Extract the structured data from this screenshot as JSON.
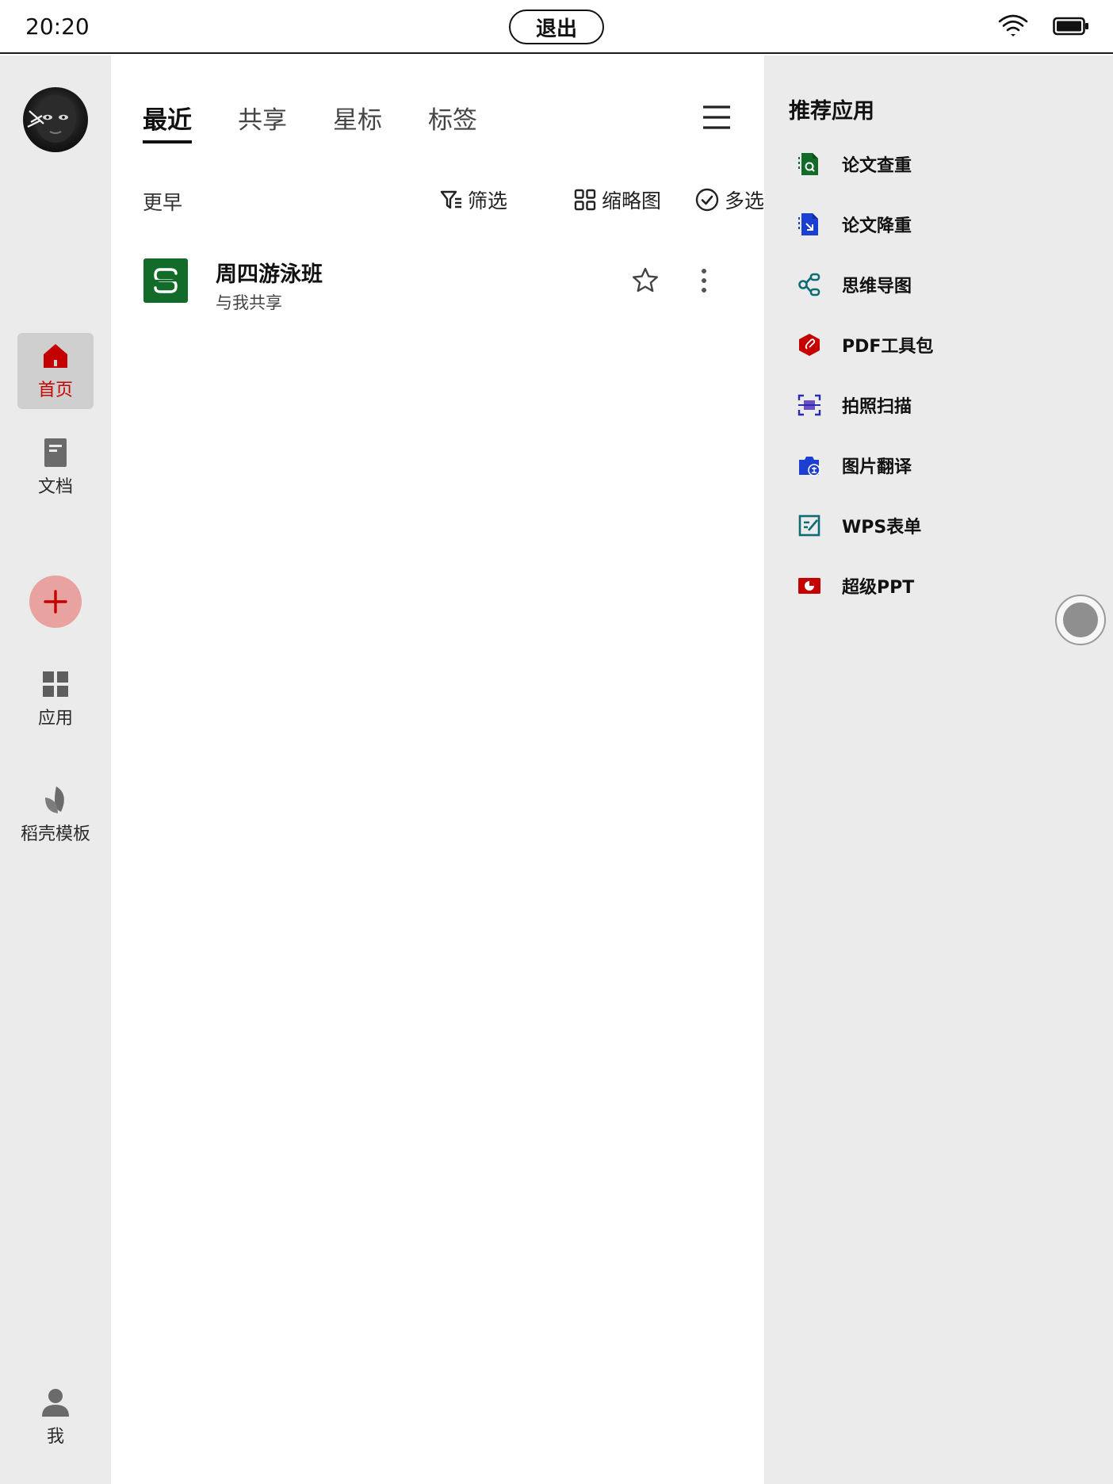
{
  "status_bar": {
    "time": "20:20",
    "exit_label": "退出"
  },
  "left_nav": {
    "items": [
      {
        "label": "首页",
        "icon": "home-icon",
        "active": true
      },
      {
        "label": "文档",
        "icon": "document-icon",
        "active": false
      },
      {
        "label": "应用",
        "icon": "apps-grid-icon",
        "active": false
      },
      {
        "label": "稻壳模板",
        "icon": "leaf-icon",
        "active": false
      }
    ],
    "add_icon": "plus-icon",
    "me_label": "我"
  },
  "main": {
    "tabs": [
      {
        "label": "最近",
        "active": true
      },
      {
        "label": "共享",
        "active": false
      },
      {
        "label": "星标",
        "active": false
      },
      {
        "label": "标签",
        "active": false
      }
    ],
    "section_title": "更早",
    "actions": {
      "filter": "筛选",
      "thumbnail": "缩略图",
      "multiselect": "多选"
    },
    "files": [
      {
        "name": "周四游泳班",
        "subtitle": "与我共享",
        "icon": "spreadsheet-icon",
        "icon_color": "#136b2a"
      }
    ]
  },
  "right_panel": {
    "title": "推荐应用",
    "apps": [
      {
        "label": "论文查重",
        "icon": "paper-check-icon",
        "color": "#136b2a"
      },
      {
        "label": "论文降重",
        "icon": "paper-reduce-icon",
        "color": "#1b3fd1"
      },
      {
        "label": "思维导图",
        "icon": "mindmap-icon",
        "color": "#0d6b73"
      },
      {
        "label": "PDF工具包",
        "icon": "pdf-icon",
        "color": "#c40000"
      },
      {
        "label": "拍照扫描",
        "icon": "scan-icon",
        "color": "#4a2fa0"
      },
      {
        "label": "图片翻译",
        "icon": "image-translate-icon",
        "color": "#1b3fd1"
      },
      {
        "label": "WPS表单",
        "icon": "form-icon",
        "color": "#0d6b73"
      },
      {
        "label": "超级PPT",
        "icon": "ppt-icon",
        "color": "#c40000"
      }
    ]
  },
  "colors": {
    "accent_red": "#c40000",
    "panel_bg": "#ebebeb",
    "add_button": "#e8a29f"
  }
}
